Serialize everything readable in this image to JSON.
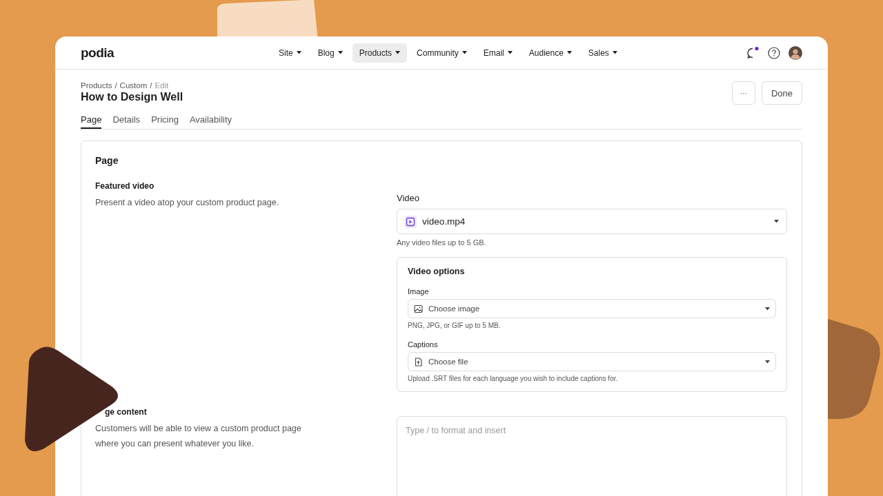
{
  "logo": "podia",
  "nav": [
    {
      "label": "Site",
      "selected": false
    },
    {
      "label": "Blog",
      "selected": false
    },
    {
      "label": "Products",
      "selected": true
    },
    {
      "label": "Community",
      "selected": false
    },
    {
      "label": "Email",
      "selected": false
    },
    {
      "label": "Audience",
      "selected": false
    },
    {
      "label": "Sales",
      "selected": false
    }
  ],
  "notifications": {
    "unread": true
  },
  "breadcrumb": {
    "separator": "/",
    "items": [
      {
        "label": "Products",
        "current": false
      },
      {
        "label": "Custom",
        "current": false
      },
      {
        "label": "Edit",
        "current": true
      }
    ]
  },
  "title": "How to Design Well",
  "actions": [
    {
      "label": "···",
      "kind": "more"
    },
    {
      "label": "Done",
      "kind": "text"
    }
  ],
  "tabs": [
    {
      "label": "Page",
      "selected": true
    },
    {
      "label": "Details",
      "selected": false
    },
    {
      "label": "Pricing",
      "selected": false
    },
    {
      "label": "Availability",
      "selected": false
    }
  ],
  "card": {
    "title": "Page",
    "featured": {
      "label": "Featured video",
      "description": "Present a video atop your custom product page.",
      "video": {
        "label": "Video",
        "value": "video.mp4",
        "hint": "Any video files up to 5 GB."
      },
      "options": {
        "title": "Video options",
        "fields": [
          {
            "label": "Image",
            "placeholder": "Choose image",
            "kind": "image",
            "hint": "PNG, JPG, or GIF up to 5 MB."
          },
          {
            "label": "Captions",
            "placeholder": "Choose file",
            "kind": "upload",
            "hint": "Upload .SRT files for each language you wish to include captions for."
          }
        ]
      }
    },
    "content": {
      "label": "ge content",
      "description": "Customers will be able to view a custom product page where you can present whatever you like.",
      "editor": {
        "placeholder": "Type / to format and insert"
      }
    }
  }
}
